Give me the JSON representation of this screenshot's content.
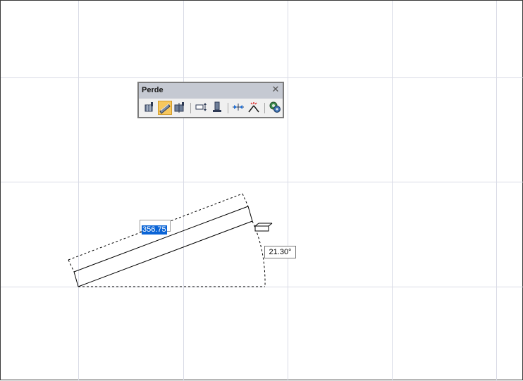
{
  "toolbar": {
    "title": "Perde",
    "close_glyph": "✕",
    "buttons": [
      {
        "icon": "wall-draw-icon",
        "active": false
      },
      {
        "icon": "wall-inclined-icon",
        "active": true
      },
      {
        "icon": "wall-split-icon",
        "active": false
      },
      {
        "icon": "wall-offset-icon",
        "active": false
      },
      {
        "icon": "wall-section-icon",
        "active": false
      },
      {
        "icon": "wall-join-icon",
        "active": false
      },
      {
        "icon": "wall-extend-icon",
        "active": false
      },
      {
        "icon": "settings-gears-icon",
        "active": false
      }
    ]
  },
  "drawing": {
    "length_value": "356.75",
    "angle_value": "21.30°"
  },
  "colors": {
    "grid": "#d9dbe6",
    "accent_active": "#f6c75e",
    "selection": "#0a64d6"
  }
}
